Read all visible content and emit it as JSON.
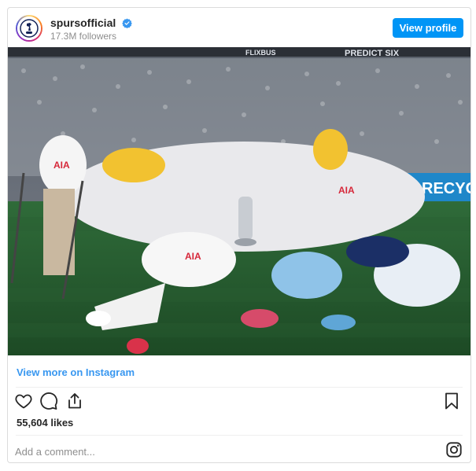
{
  "header": {
    "username": "spursofficial",
    "followers": "17.3M followers",
    "view_profile_label": "View profile",
    "verified_icon": "verified-badge-icon",
    "avatar_icon": "spurs-crest-icon"
  },
  "photo": {
    "banner_left": "FLIXBUS",
    "banner_right": "PREDICT SIX",
    "board_text": "RECYC",
    "shirt_sponsor": "AIA"
  },
  "link": {
    "view_more_label": "View more on Instagram"
  },
  "actions": {
    "like_icon": "heart-icon",
    "comment_icon": "comment-icon",
    "share_icon": "share-icon",
    "save_icon": "bookmark-icon"
  },
  "likes": "55,604 likes",
  "comment": {
    "placeholder": "Add a comment..."
  },
  "colors": {
    "accent": "#0095f6",
    "link": "#3897f0",
    "border": "#dbdbdb"
  }
}
